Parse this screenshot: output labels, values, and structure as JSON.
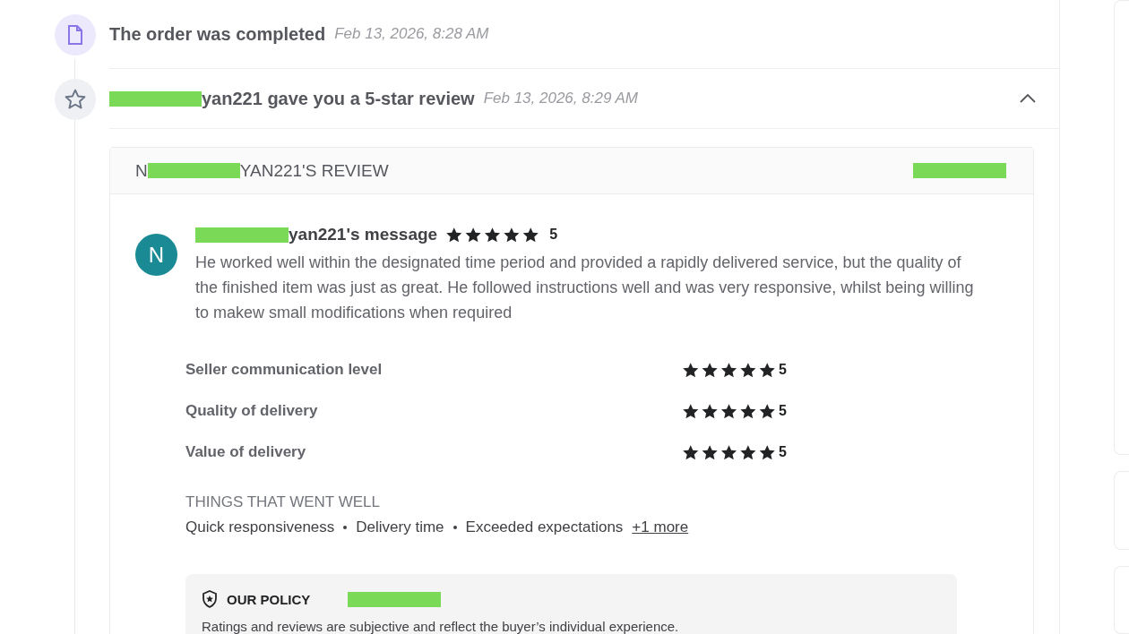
{
  "events": [
    {
      "kind": "order",
      "title": "The order was completed",
      "time": "Feb 13, 2026, 8:28 AM"
    },
    {
      "kind": "review",
      "title": "yan221 gave you a 5-star review",
      "time": "Feb 13, 2026, 8:29 AM",
      "expanded": true
    }
  ],
  "review": {
    "title_prefix": "N",
    "title_suffix": "YAN221'S REVIEW",
    "avatar": "N",
    "message_title": "yan221's message",
    "stars": 5,
    "score": "5",
    "message": "He worked well within the designated time period and provided a rapidly delivered service, but the quality of the finished item was just as great. He followed instructions well and was very responsive, whilst being willing to makew small modifications when required",
    "ratings": [
      {
        "label": "Seller communication level",
        "stars": 5,
        "score": "5"
      },
      {
        "label": "Quality of delivery",
        "stars": 5,
        "score": "5"
      },
      {
        "label": "Value of delivery",
        "stars": 5,
        "score": "5"
      }
    ],
    "went_well_title": "THINGS THAT WENT WELL",
    "went_well": [
      "Quick responsiveness",
      "Delivery time",
      "Exceeded expectations"
    ],
    "more_link": "+1 more",
    "policy": {
      "title": "OUR POLICY",
      "text": "Ratings and reviews are subjective and reflect the buyer’s individual experience."
    }
  }
}
